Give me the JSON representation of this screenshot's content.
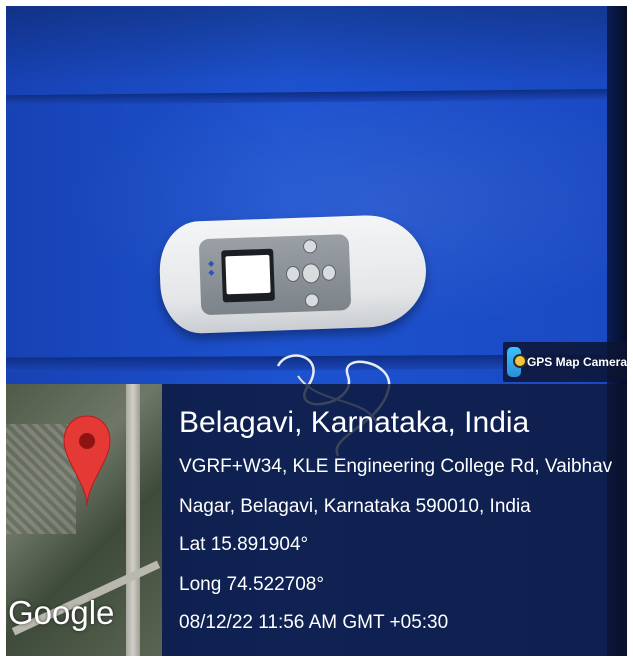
{
  "badge": {
    "icon": "gps-map-camera-app-icon",
    "label": "GPS Map Camera"
  },
  "map": {
    "pin_icon": "map-pin-icon",
    "wordmark": "Google"
  },
  "location": {
    "title": "Belagavi, Karnataka, India",
    "address_line1": "VGRF+W34, KLE Engineering College Rd, Vaibhav",
    "address_line2": "Nagar, Belagavi, Karnataka 590010, India",
    "latitude": "Lat 15.891904°",
    "longitude": "Long 74.522708°",
    "timestamp": "08/12/22 11:56 AM GMT +05:30"
  },
  "colors": {
    "mat": "#1d52cf",
    "overlay": "#0c1430",
    "pin": "#e53935"
  }
}
